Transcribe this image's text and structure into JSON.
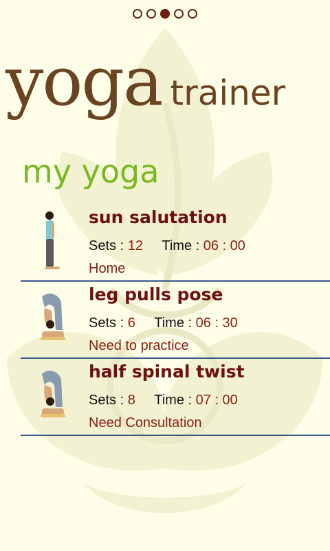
{
  "pager": {
    "count": 5,
    "active_index": 2
  },
  "logo": {
    "word1": "yoga",
    "word2": "trainer"
  },
  "section_title": "my yoga",
  "labels": {
    "sets": "Sets :",
    "time": "Time :"
  },
  "items": [
    {
      "name": "sun salutation",
      "sets": "12",
      "time": "06 : 00",
      "note": "Home",
      "icon": "standing-pose-icon"
    },
    {
      "name": "leg pulls pose",
      "sets": "6",
      "time": "06 : 30",
      "note": "Need to practice",
      "icon": "forward-bend-pose-icon"
    },
    {
      "name": "half spinal twist",
      "sets": "8",
      "time": "07 : 00",
      "note": "Need Consultation",
      "icon": "forward-bend-pose-icon"
    }
  ],
  "colors": {
    "background": "#fefee8",
    "accent_green": "#79b820",
    "title_maroon": "#6e1010",
    "value_red": "#8a1e10",
    "divider_blue": "#3b5a8c"
  }
}
